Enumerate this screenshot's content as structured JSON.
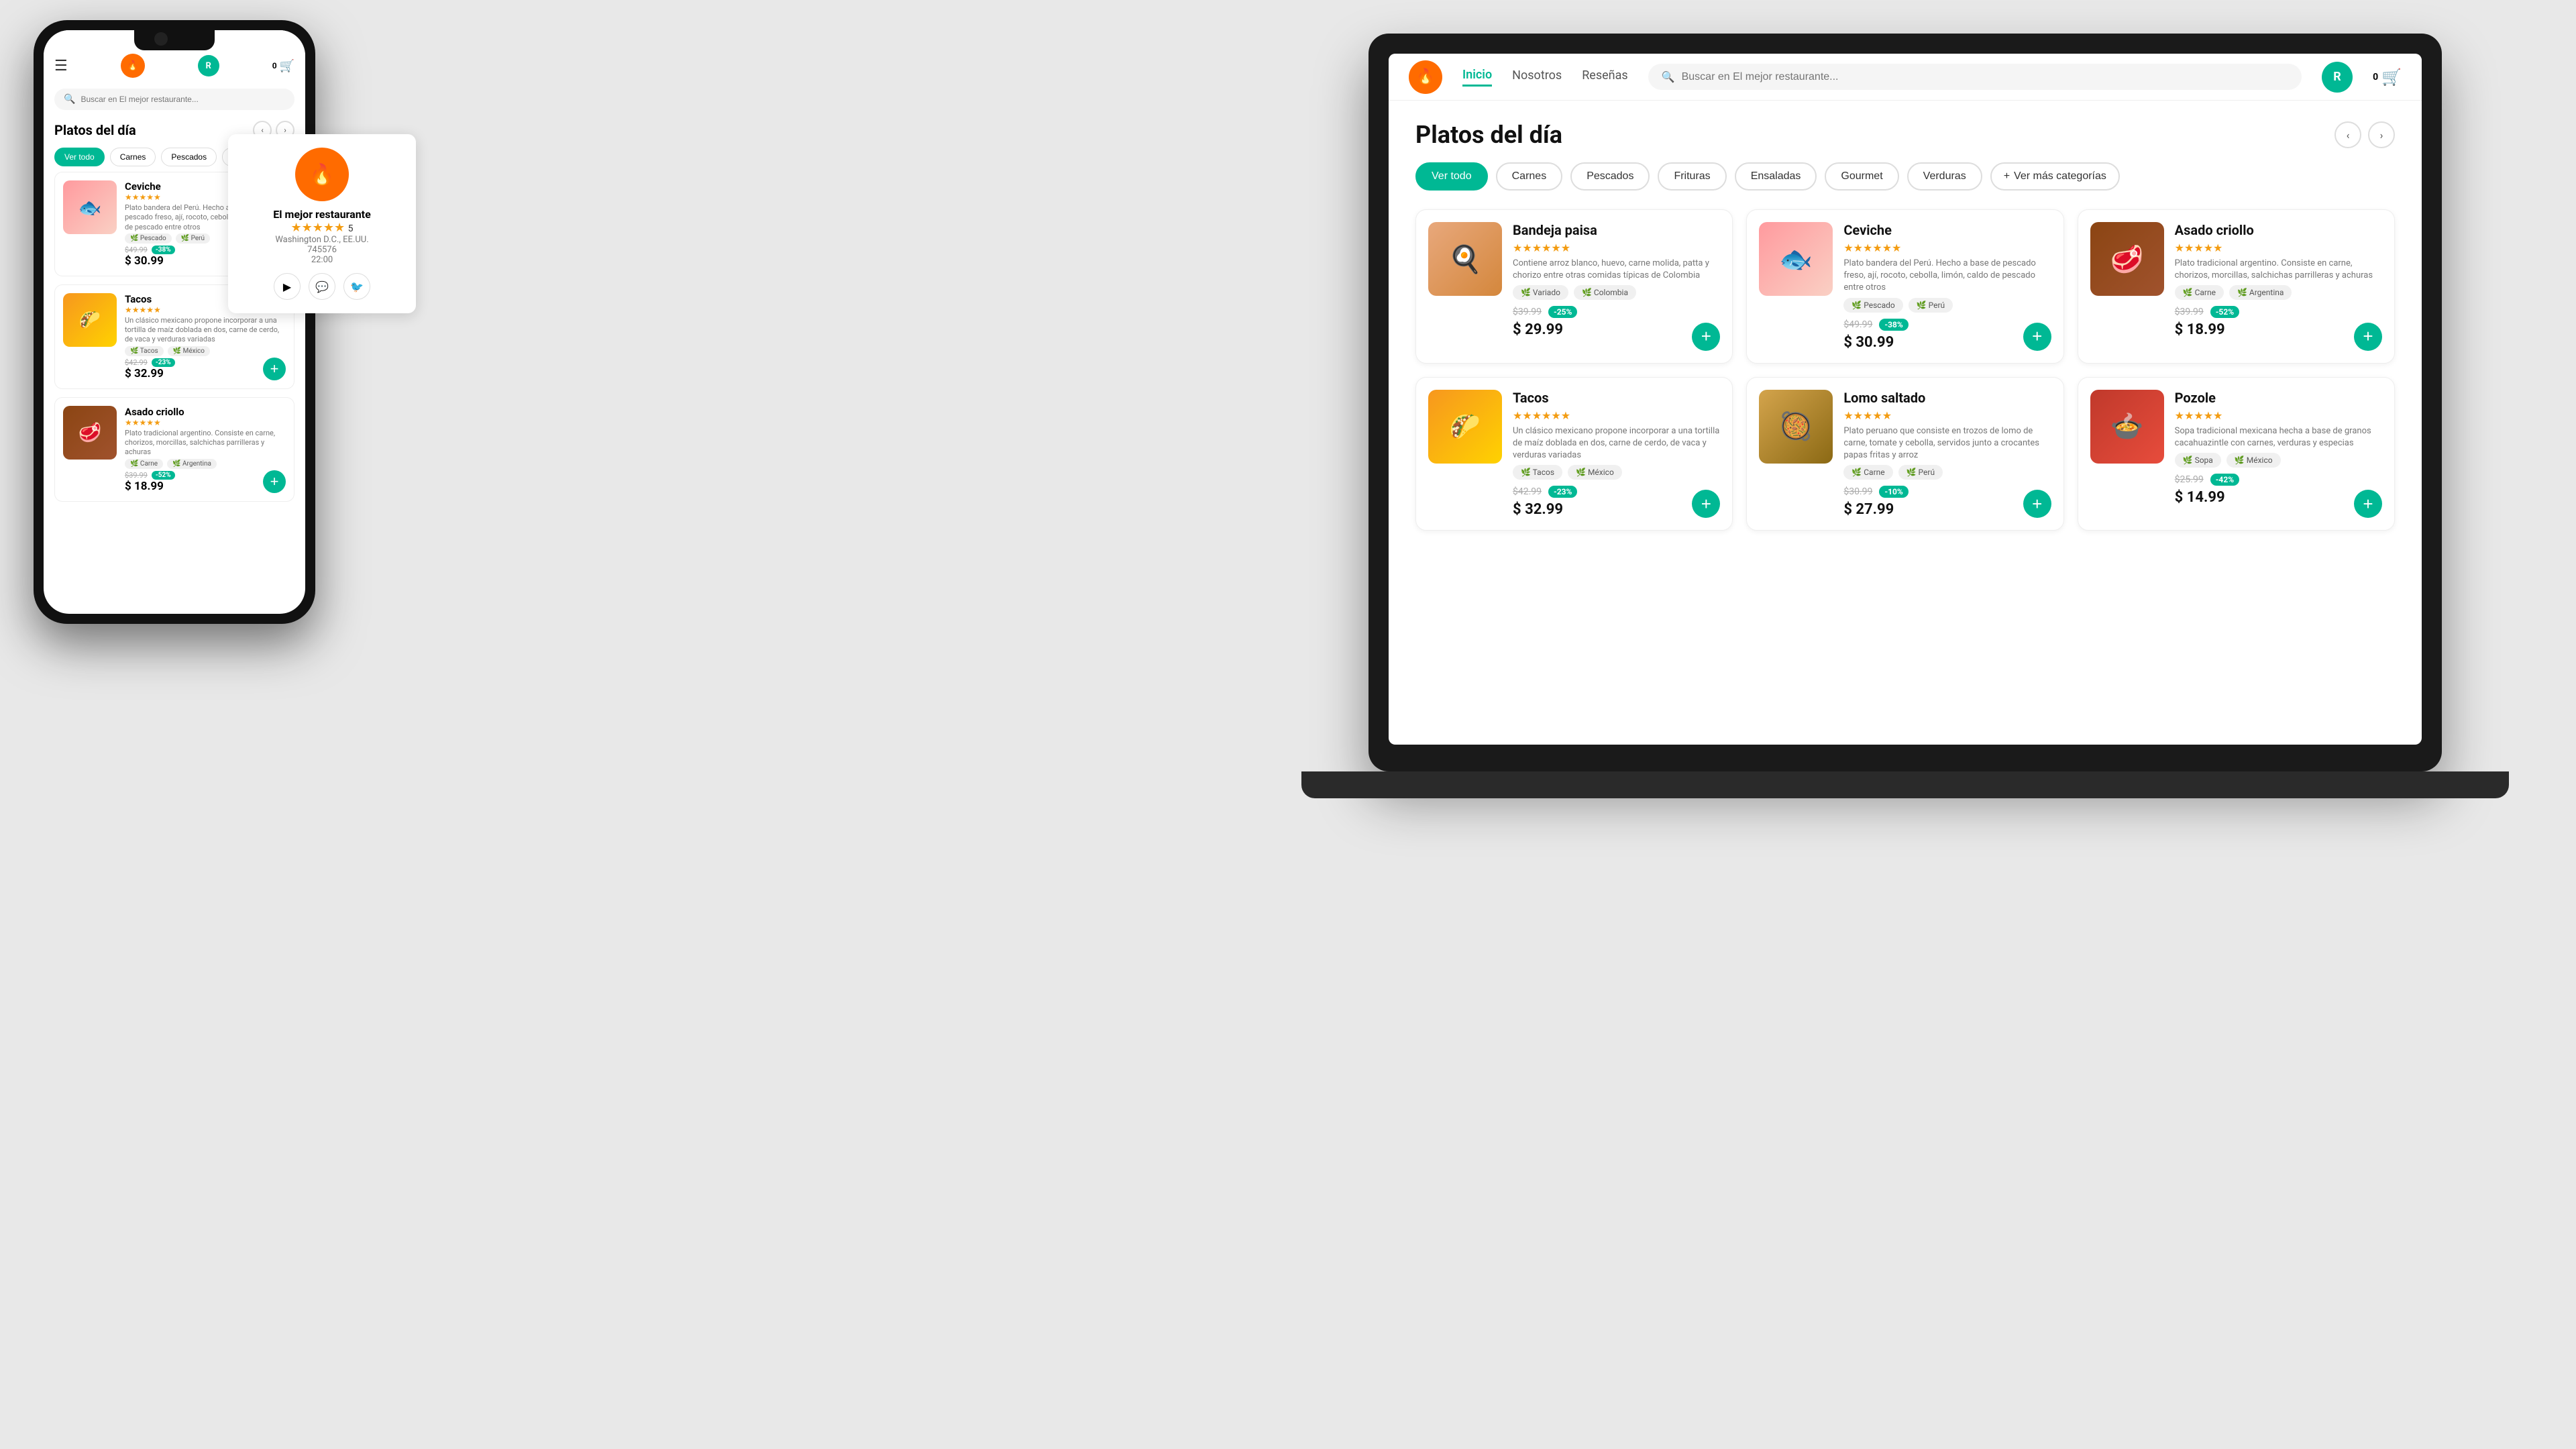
{
  "app": {
    "title": "El mejor restaurante",
    "logo_text": "🔥",
    "avatar_initial": "R",
    "cart_count": "0"
  },
  "nav": {
    "links": [
      {
        "label": "Inicio",
        "active": true
      },
      {
        "label": "Nosotros",
        "active": false
      },
      {
        "label": "Reseñas",
        "active": false
      }
    ],
    "search_placeholder": "Buscar en El mejor restaurante...",
    "cart_label": "0"
  },
  "section": {
    "title": "Platos del día"
  },
  "categories": [
    {
      "label": "Ver todo",
      "active": true
    },
    {
      "label": "Carnes",
      "active": false
    },
    {
      "label": "Pescados",
      "active": false
    },
    {
      "label": "Frituras",
      "active": false
    },
    {
      "label": "Ensaladas",
      "active": false
    },
    {
      "label": "Gourmet",
      "active": false
    },
    {
      "label": "Verduras",
      "active": false
    },
    {
      "label": "+ Ver más categorías",
      "active": false
    }
  ],
  "products": [
    {
      "name": "Bandeja paisa",
      "stars": "★★★★★★",
      "desc": "Contiene arroz blanco, huevo, carne molida, patta y chorizo entre otras comidas típicas de Colombia",
      "tags": [
        "Variado",
        "Colombia"
      ],
      "price_old": "$39.99",
      "discount": "-25%",
      "price_new": "$29.99",
      "img_class": "food-img-bandeja"
    },
    {
      "name": "Ceviche",
      "stars": "★★★★★★",
      "desc": "Plato bandera del Perú. Hecho a base de pescado freso, ají, rocoto, cebolla, limón, caldo de pescado entre otros",
      "tags": [
        "Pescado",
        "Perú"
      ],
      "price_old": "$49.99",
      "discount": "-38%",
      "price_new": "$30.99",
      "img_class": "food-img-ceviche"
    },
    {
      "name": "Asado criollo",
      "stars": "★★★★★",
      "desc": "Plato tradicional argentino. Consiste en carne, chorizos, morcillas, salchichas parrilleras y achuras",
      "tags": [
        "Carne",
        "Argentina"
      ],
      "price_old": "$39.99",
      "discount": "-52%",
      "price_new": "$18.99",
      "img_class": "food-img-asado"
    },
    {
      "name": "Tacos",
      "stars": "★★★★★★",
      "desc": "Un clásico mexicano propone incorporar a una tortilla de maíz doblada en dos, carne de cerdo, de vaca y verduras variadas",
      "tags": [
        "Tacos",
        "México"
      ],
      "price_old": "$42.99",
      "discount": "-23%",
      "price_new": "$32.99",
      "img_class": "food-img-tacos"
    },
    {
      "name": "Lomo saltado",
      "stars": "★★★★★",
      "desc": "Plato peruano que consiste en trozos de lomo de carne, tomate y cebolla, servidos junto a crocantes papas fritas y arroz",
      "tags": [
        "Carne",
        "Perú"
      ],
      "price_old": "$30.99",
      "discount": "-10%",
      "price_new": "$27.99",
      "img_class": "food-img-lomo"
    },
    {
      "name": "Pozole",
      "stars": "★★★★★",
      "desc": "Sopa tradicional mexicana hecha a base de granos cacahuazintle con carnes, verduras y especias",
      "tags": [
        "Sopa",
        "México"
      ],
      "price_old": "$25.99",
      "discount": "-42%",
      "price_new": "$14.99",
      "img_class": "food-img-pozole"
    }
  ],
  "phone": {
    "search_placeholder": "Buscar en El mejor restaurante...",
    "section_title": "Platos del día",
    "categories": [
      "Ver todo",
      "Carnes",
      "Pescados",
      "Frituras"
    ],
    "products": [
      {
        "name": "Ceviche",
        "stars": "★★★★★",
        "desc": "Plato bandera del Perú. Hecho a base de pescado freso, ají, rocoto, cebolla, limón, caldo de pescado entre otros",
        "tags": [
          "Pescado",
          "Perú"
        ],
        "price_old": "$49.99",
        "discount": "-38%",
        "price_new": "$30.99",
        "img_class": "food-img-ceviche"
      },
      {
        "name": "Tacos",
        "stars": "★★★★★",
        "desc": "Un clásico mexicano propone incorporar a una tortilla de maíz doblada en dos, carne de cerdo, de vaca y verduras variadas",
        "tags": [
          "Tacos",
          "México"
        ],
        "price_old": "$42.99",
        "discount": "-23%",
        "price_new": "$32.99",
        "img_class": "food-img-tacos"
      },
      {
        "name": "Asado criollo",
        "stars": "★★★★★",
        "desc": "Plato tradicional argentino. Consiste en carne, chorizos, morcillas, salchichas parrilleras y achuras",
        "tags": [
          "Carne",
          "Argentina"
        ],
        "price_old": "$39.99",
        "discount": "-52%",
        "price_new": "$18.99",
        "img_class": "food-img-asado"
      }
    ]
  },
  "restaurant": {
    "name": "El mejor restaurante",
    "rating": "★★★★★",
    "rating_number": "5",
    "location": "Washington D.C., EE.UU.",
    "phone": "745576",
    "hours": "22:00",
    "logo_text": "🔥"
  },
  "colors": {
    "primary": "#00b894",
    "accent": "#ff6b00",
    "star": "#f39c12",
    "discount": "#00b894"
  }
}
